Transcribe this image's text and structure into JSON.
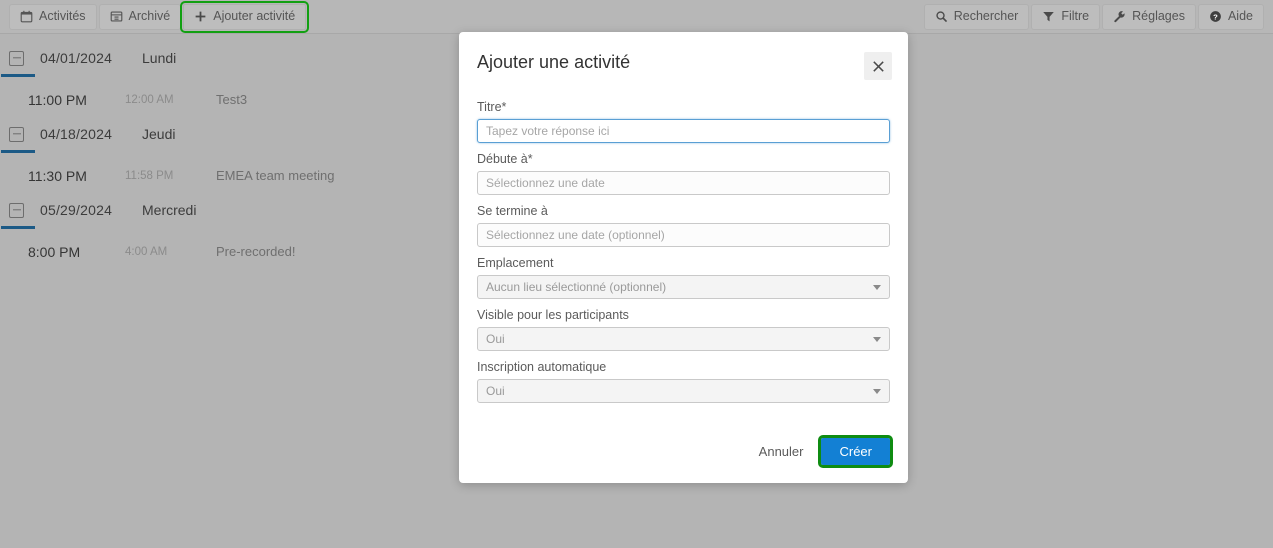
{
  "toolbar": {
    "left_buttons": [
      {
        "label": "Activités",
        "icon": "calendar-icon",
        "highlighted": false
      },
      {
        "label": "Archivé",
        "icon": "archive-icon",
        "highlighted": false
      },
      {
        "label": "Ajouter activité",
        "icon": "plus-icon",
        "highlighted": true
      }
    ],
    "right_buttons": [
      {
        "label": "Rechercher",
        "icon": "search-icon"
      },
      {
        "label": "Filtre",
        "icon": "filter-icon"
      },
      {
        "label": "Réglages",
        "icon": "wrench-icon"
      },
      {
        "label": "Aide",
        "icon": "help-circle-icon"
      }
    ]
  },
  "activity_list": {
    "days": [
      {
        "date": "04/01/2024",
        "weekday": "Lundi",
        "activities": [
          {
            "start": "11:00 PM",
            "end": "12:00 AM",
            "title": "Test3"
          }
        ]
      },
      {
        "date": "04/18/2024",
        "weekday": "Jeudi",
        "activities": [
          {
            "start": "11:30 PM",
            "end": "11:58 PM",
            "title": "EMEA team meeting"
          }
        ]
      },
      {
        "date": "05/29/2024",
        "weekday": "Mercredi",
        "activities": [
          {
            "start": "8:00 PM",
            "end": "4:00 AM",
            "title": "Pre-recorded!"
          }
        ]
      }
    ]
  },
  "modal": {
    "title": "Ajouter une activité",
    "close_icon": "close-icon",
    "fields": {
      "title": {
        "label": "Titre*",
        "placeholder": "Tapez votre réponse ici",
        "value": "",
        "focused": true
      },
      "starts_at": {
        "label": "Débute à*",
        "placeholder": "Sélectionnez une date",
        "value": ""
      },
      "ends_at": {
        "label": "Se termine à",
        "placeholder": "Sélectionnez une date (optionnel)",
        "value": ""
      },
      "location": {
        "label": "Emplacement",
        "selected": "Aucun lieu sélectionné (optionnel)"
      },
      "visible_to_participants": {
        "label": "Visible pour les participants",
        "selected": "Oui"
      },
      "auto_registration": {
        "label": "Inscription automatique",
        "selected": "Oui"
      }
    },
    "footer": {
      "cancel_label": "Annuler",
      "create_label": "Créer"
    }
  },
  "colors": {
    "page_background": "#b4b4b4",
    "toolbar_background": "#b7b7b7",
    "modal_background": "#ffffff",
    "accent_blue": "#1380d4",
    "day_underline_blue": "#1c5a86",
    "highlight_green": "#0f8c12",
    "focus_blue": "#5a9fd4"
  }
}
